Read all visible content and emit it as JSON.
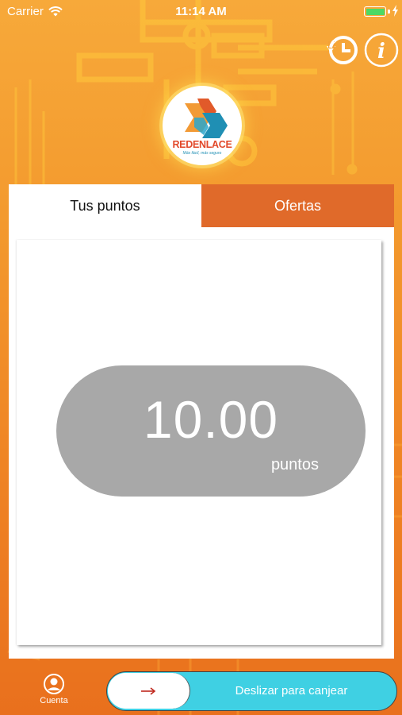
{
  "status_bar": {
    "carrier": "Carrier",
    "time": "11:14 AM",
    "battery_level": 1.0
  },
  "header": {
    "history_icon": "history-clock-icon",
    "info_icon": "info-icon"
  },
  "logo": {
    "brand_red": "REDENLACE",
    "tagline": "Más fácil, más seguro"
  },
  "tabs": [
    {
      "label": "Tus puntos",
      "active": true
    },
    {
      "label": "Ofertas",
      "active": false
    }
  ],
  "points": {
    "value": "10.00",
    "unit": "puntos"
  },
  "bottom": {
    "account_label": "Cuenta",
    "slider_label": "Deslizar para canjear",
    "slider_icon": "arrow-right-icon"
  },
  "colors": {
    "background_top": "#f7a93a",
    "background_bottom": "#e9701d",
    "active_tab_bg": "#ffffff",
    "inactive_tab_bg": "#e06a2a",
    "points_pill": "#a8a8a8",
    "slider_bg": "#3fd0e3",
    "arrow": "#c0281e"
  }
}
